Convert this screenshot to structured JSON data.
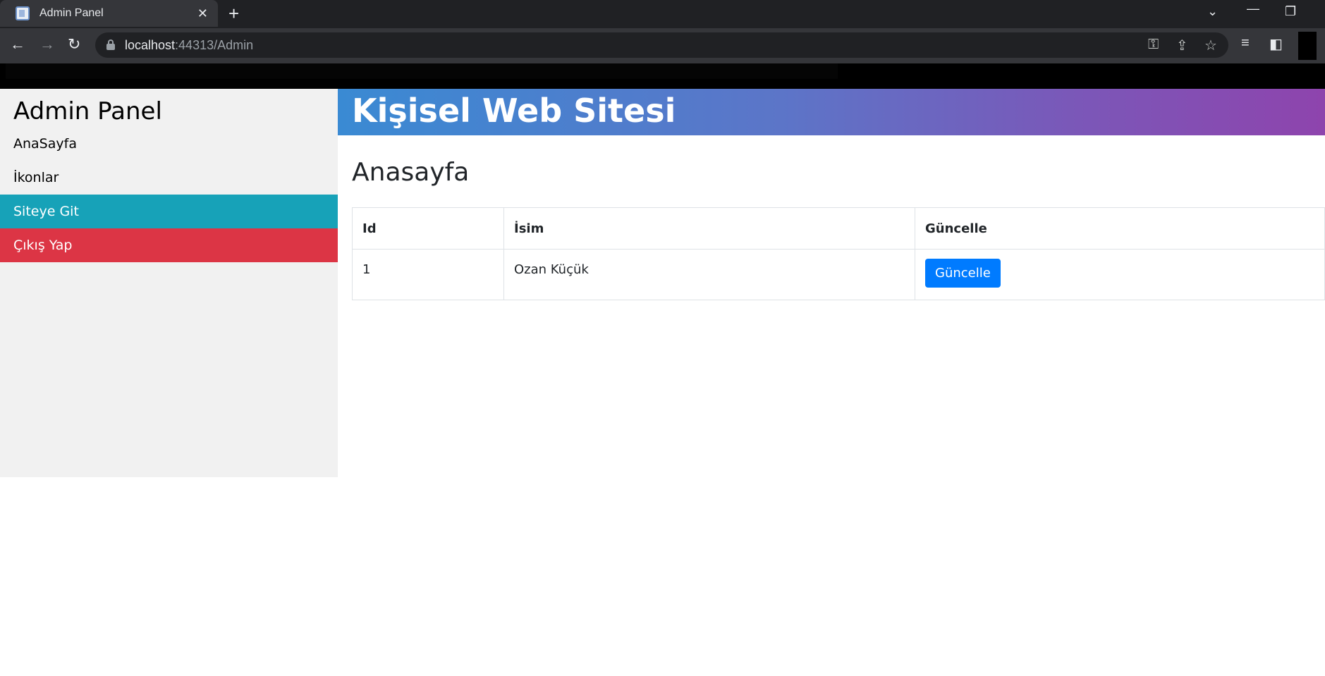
{
  "browser": {
    "tab_title": "Admin Panel",
    "tab_close": "✕",
    "new_tab": "+",
    "url_host": "localhost",
    "url_rest": ":44313/Admin"
  },
  "sidebar": {
    "title": "Admin Panel",
    "items": [
      {
        "label": "AnaSayfa"
      },
      {
        "label": "İkonlar"
      },
      {
        "label": "Siteye Git"
      },
      {
        "label": "Çıkış Yap"
      }
    ]
  },
  "header": {
    "title": "Kişisel Web Sitesi"
  },
  "main": {
    "title": "Anasayfa",
    "table": {
      "columns": [
        "Id",
        "İsim",
        "Güncelle"
      ],
      "rows": [
        {
          "id": "1",
          "name": "Ozan Küçük",
          "action": "Güncelle"
        }
      ]
    }
  },
  "colors": {
    "active_item": "#17a2b8",
    "danger_item": "#dc3545",
    "button": "#007bff",
    "banner_start": "#3a8ad3",
    "banner_end": "#8e44ad"
  }
}
